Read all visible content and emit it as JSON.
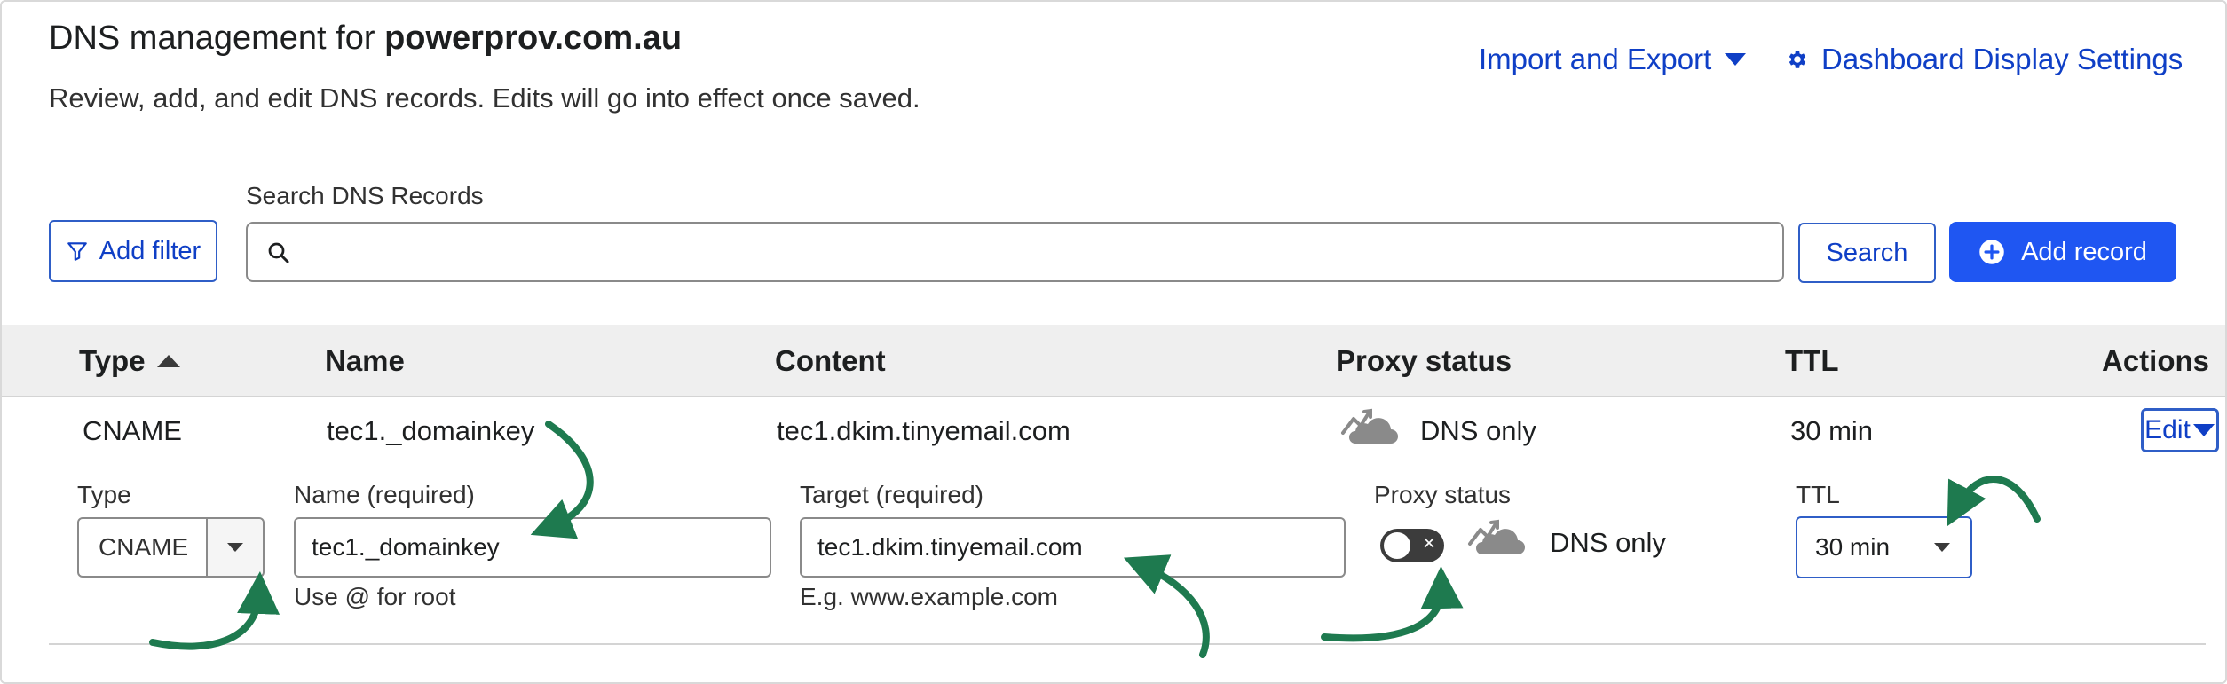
{
  "header": {
    "title_prefix": "DNS management for ",
    "domain": "powerprov.com.au",
    "subtitle": "Review, add, and edit DNS records. Edits will go into effect once saved.",
    "import_export": "Import and Export",
    "display_settings": "Dashboard Display Settings"
  },
  "toolbar": {
    "add_filter": "Add filter",
    "search_label": "Search DNS Records",
    "search_placeholder": "",
    "search_button": "Search",
    "add_record": "Add record"
  },
  "table": {
    "columns": [
      "Type",
      "Name",
      "Content",
      "Proxy status",
      "TTL",
      "Actions"
    ],
    "row": {
      "type": "CNAME",
      "name": "tec1._domainkey",
      "content": "tec1.dkim.tinyemail.com",
      "proxy_status": "DNS only",
      "ttl": "30 min",
      "action": "Edit"
    }
  },
  "edit_form": {
    "type_label": "Type",
    "type_value": "CNAME",
    "name_label": "Name (required)",
    "name_value": "tec1._domainkey",
    "name_hint": "Use @ for root",
    "target_label": "Target (required)",
    "target_value": "tec1.dkim.tinyemail.com",
    "target_hint": "E.g. www.example.com",
    "proxy_label": "Proxy status",
    "proxy_value": "DNS only",
    "proxy_enabled": false,
    "ttl_label": "TTL",
    "ttl_value": "30 min"
  },
  "colors": {
    "accent": "#1f56f2",
    "link": "#0f3fc6",
    "annotation_arrow": "#1e7a4f",
    "header_bg": "#efefef"
  }
}
